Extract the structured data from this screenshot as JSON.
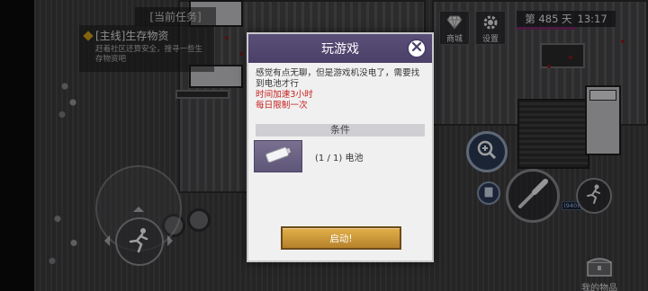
{
  "quest": {
    "header": "[当前任务]",
    "title": "[主线]生存物资",
    "description": "赶着社区还算安全，搜寻一些生存物资吧"
  },
  "hud": {
    "shop_label": "商城",
    "settings_label": "设置",
    "day_label": "第 485 天",
    "time": "13:17"
  },
  "controls": {
    "ammo_count": "(940)",
    "inventory_label": "我的物品"
  },
  "modal": {
    "title": "玩游戏",
    "description": "感觉有点无聊，但是游戏机没电了，需要找到电池才行",
    "effect": "时间加速3小时",
    "limit": "每日限制一次",
    "conditions_label": "条件",
    "requirement_count": "(1 / 1)",
    "requirement_item": "电池",
    "start_label": "启动!"
  },
  "colors": {
    "modal_header": "#4a4068",
    "warning_red": "#c81e1e",
    "start_button": "#d29b3c",
    "day_accent": "#7a2a6a"
  },
  "icons": [
    "diamond-shop-icon",
    "gear-icon",
    "close-icon",
    "battery-icon",
    "zoom-icon",
    "book-icon",
    "bat-weapon-icon",
    "sprint-icon",
    "runner-icon",
    "chest-icon"
  ]
}
